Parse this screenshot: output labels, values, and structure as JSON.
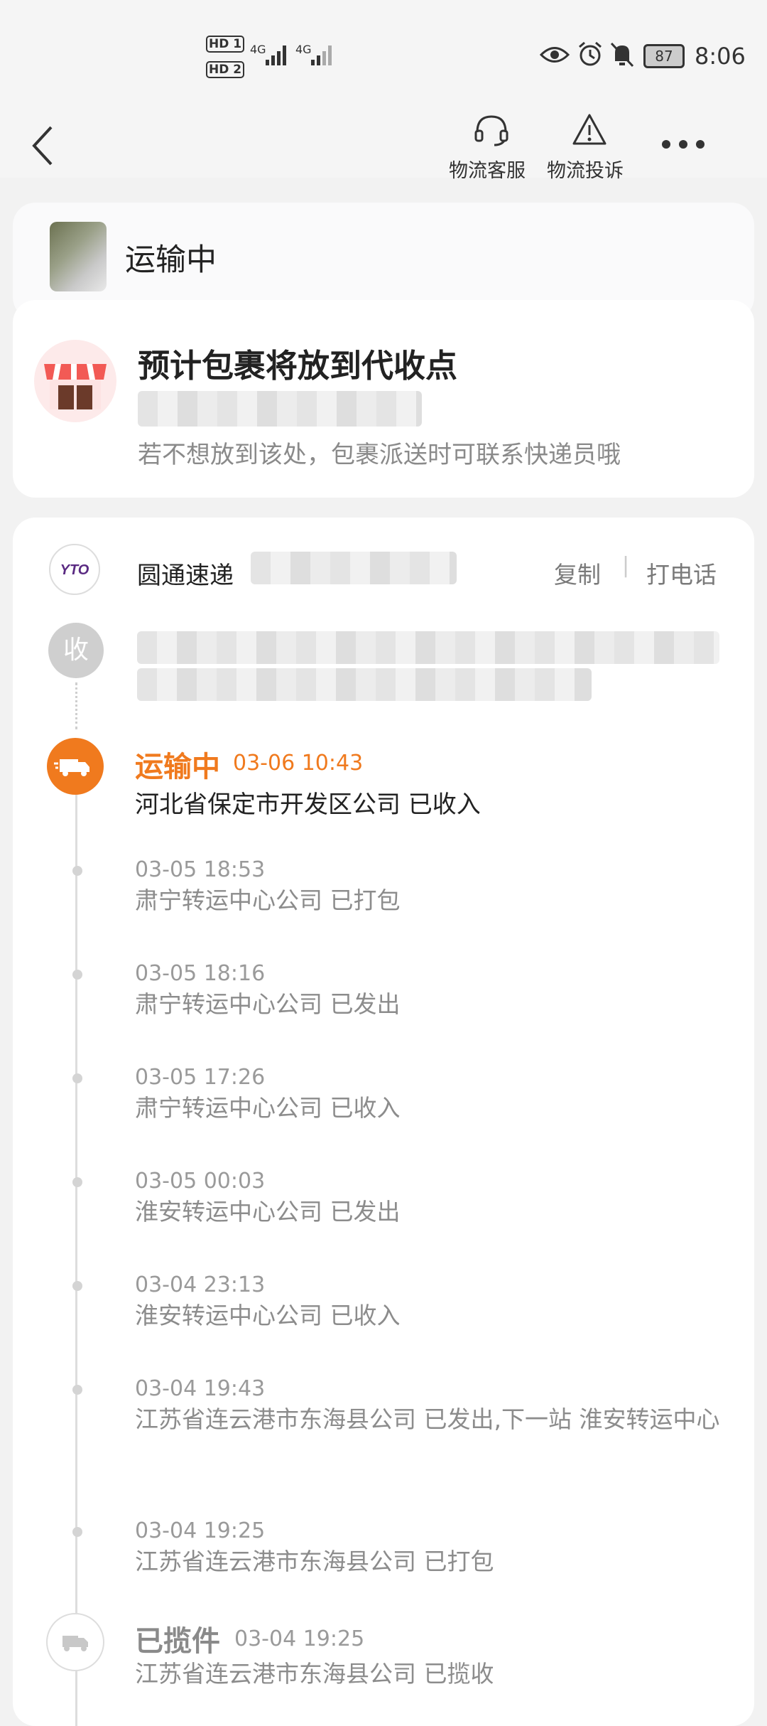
{
  "status_bar": {
    "sim1": "HD 1",
    "sim2": "HD 2",
    "net1": "4G",
    "net2": "4G",
    "battery": "87",
    "time": "8:06"
  },
  "nav": {
    "service_label": "物流客服",
    "complaint_label": "物流投诉"
  },
  "header": {
    "status": "运输中"
  },
  "delivery": {
    "title": "预计包裹将放到代收点",
    "note": "若不想放到该处，包裹派送时可联系快递员哦"
  },
  "carrier": {
    "logo_text": "YTO",
    "name": "圆通速递",
    "copy_label": "复制",
    "divider": "|",
    "call_label": "打电话"
  },
  "receiver": {
    "badge": "收"
  },
  "current": {
    "status": "运输中",
    "time": "03-06  10:43",
    "desc": "河北省保定市开发区公司 已收入"
  },
  "events": [
    {
      "time": "03-05  18:53",
      "desc": "肃宁转运中心公司 已打包"
    },
    {
      "time": "03-05  18:16",
      "desc": "肃宁转运中心公司 已发出"
    },
    {
      "time": "03-05  17:26",
      "desc": "肃宁转运中心公司 已收入"
    },
    {
      "time": "03-05  00:03",
      "desc": "淮安转运中心公司 已发出"
    },
    {
      "time": "03-04  23:13",
      "desc": "淮安转运中心公司 已收入"
    },
    {
      "time": "03-04  19:43",
      "desc": "江苏省连云港市东海县公司 已发出,下一站 淮安转运中心"
    },
    {
      "time": "03-04  19:25",
      "desc": "江苏省连云港市东海县公司 已打包"
    }
  ],
  "picked_up": {
    "status": "已揽件",
    "time": "03-04  19:25",
    "desc": "江苏省连云港市东海县公司 已揽收"
  },
  "colors": {
    "accent_orange": "#f07a1e",
    "store_red": "#f25a55"
  }
}
